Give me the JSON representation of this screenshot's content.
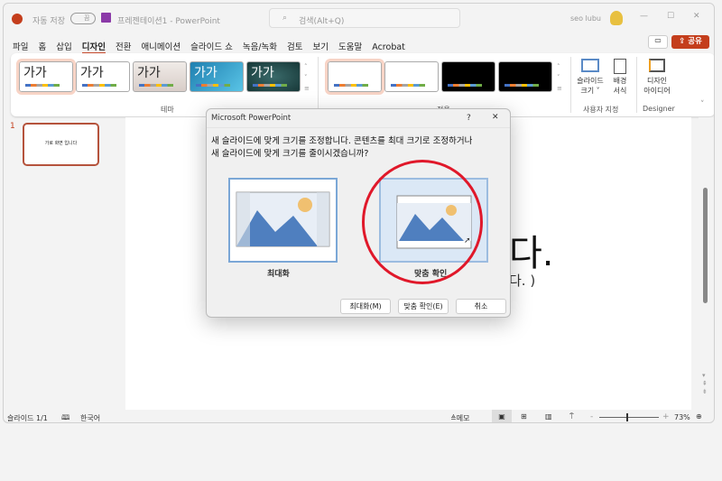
{
  "titlebar": {
    "autosave": "자동 저장",
    "toggle": "끔",
    "doc": "프레젠테이션1 - PowerPoint",
    "search": "검색(Alt+Q)",
    "user": "seo lubu"
  },
  "menu": [
    "파일",
    "홈",
    "삽입",
    "디자인",
    "전환",
    "애니메이션",
    "슬라이드 쇼",
    "녹음/녹화",
    "검토",
    "보기",
    "도움말",
    "Acrobat"
  ],
  "share": "공유",
  "ribbon": {
    "theme_sample": "가가",
    "theme_group": "테마",
    "variant_group": "적용",
    "slide_size": "슬라이드",
    "slide_size2": "크기 ˅",
    "bg": "배경",
    "bg2": "서식",
    "custom_group": "사용자 지정",
    "design": "디자인",
    "design2": "아이디어",
    "designer_group": "Designer"
  },
  "thumb": {
    "num": "1",
    "text": "가로 화면 입니다"
  },
  "slide": {
    "title_frag": "다.",
    "sub_frag": "다. )"
  },
  "dialog": {
    "title": "Microsoft PowerPoint",
    "help": "?",
    "close": "✕",
    "msg1": "새 슬라이드에 맞게 크기를 조정합니다. 콘텐츠를 최대 크기로 조정하거나",
    "msg2": "새 슬라이드에 맞게 크기를 줄이시겠습니까?",
    "opt1": "최대화",
    "opt2": "맞춤 확인",
    "btn1": "최대화(M)",
    "btn2": "맞춤 확인(E)",
    "btn3": "취소"
  },
  "status": {
    "slide": "슬라이드 1/1",
    "lang": "한국어",
    "notes": "메모",
    "zoom": "73%",
    "zoom_fraction": 0.45
  }
}
